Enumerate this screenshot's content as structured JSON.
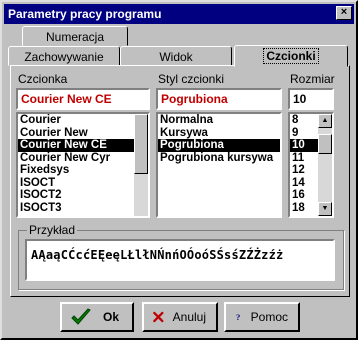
{
  "window": {
    "title": "Parametry pracy programu",
    "close_label": "×"
  },
  "tabs": [
    {
      "label": "Numeracja"
    },
    {
      "label": "Zachowywanie"
    },
    {
      "label": "Widok"
    },
    {
      "label": "Czcionki"
    }
  ],
  "font": {
    "label": "Czcionka",
    "current": "Courier New CE",
    "items": [
      "Courier",
      "Courier New",
      "Courier New CE",
      "Courier New Cyr",
      "Fixedsys",
      "ISOCT",
      "ISOCT2",
      "ISOCT3"
    ],
    "selected_index": 2
  },
  "style": {
    "label": "Styl czcionki",
    "current": "Pogrubiona",
    "items": [
      "Normalna",
      "Kursywa",
      "Pogrubiona",
      "Pogrubiona kursywa"
    ],
    "selected_index": 2
  },
  "size": {
    "label": "Rozmiar",
    "current": "10",
    "items": [
      "8",
      "9",
      "10",
      "11",
      "12",
      "14",
      "16",
      "18"
    ],
    "selected_index": 2
  },
  "preview": {
    "label": "Przykład",
    "sample": "AĄaąCĆcćEĘeęLŁlłNŃnńOÓoóSŚsśZŹŻzźż"
  },
  "buttons": {
    "ok": "Ok",
    "cancel": "Anuluj",
    "help": "Pomoc"
  },
  "colors": {
    "title_bar": "#000080",
    "field_text": "#c00000",
    "ok_icon": "#008000",
    "cancel_icon": "#c00000",
    "help_icon": "#000080"
  }
}
